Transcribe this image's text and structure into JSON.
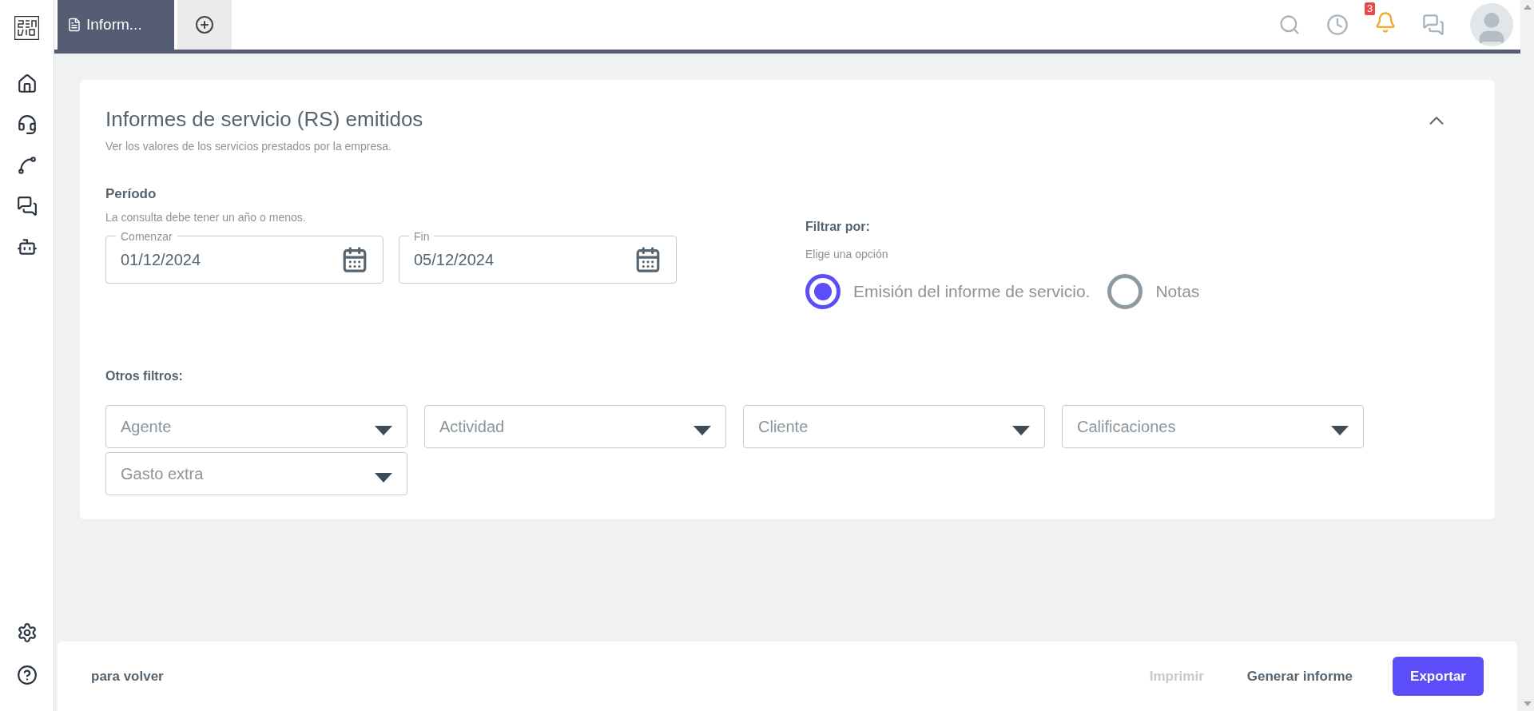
{
  "tabs": [
    {
      "label": "Inform...",
      "selected": true
    },
    {
      "kind": "add",
      "selected": false
    }
  ],
  "notifications": {
    "badge": "3"
  },
  "card": {
    "title": "Informes de servicio (RS) emitidos",
    "subtitle": "Ver los valores de los servicios prestados por la empresa.",
    "expanded": true
  },
  "period": {
    "label": "Período",
    "hint": "La consulta debe tener un año o menos.",
    "fields": [
      {
        "label": "Comenzar",
        "value": "01/12/2024"
      },
      {
        "label": "Fin",
        "value": "05/12/2024"
      }
    ]
  },
  "filter": {
    "label": "Filtrar por:",
    "hint": "Elige una opción",
    "options": [
      {
        "label": "Emisión del informe de servicio.",
        "selected": true
      },
      {
        "label": "Notas",
        "selected": false
      }
    ]
  },
  "other_filters": {
    "label": "Otros filtros:",
    "dropdowns": [
      {
        "placeholder": "Agente"
      },
      {
        "placeholder": "Actividad"
      },
      {
        "placeholder": "Cliente"
      },
      {
        "placeholder": "Calificaciones"
      },
      {
        "placeholder": "Gasto extra"
      }
    ]
  },
  "footer": {
    "back": "para volver",
    "buttons": [
      {
        "label": "Imprimir",
        "kind": "text",
        "disabled": true
      },
      {
        "label": "Generar informe",
        "kind": "text",
        "disabled": false
      },
      {
        "label": "Exportar",
        "kind": "primary",
        "disabled": false
      }
    ]
  }
}
